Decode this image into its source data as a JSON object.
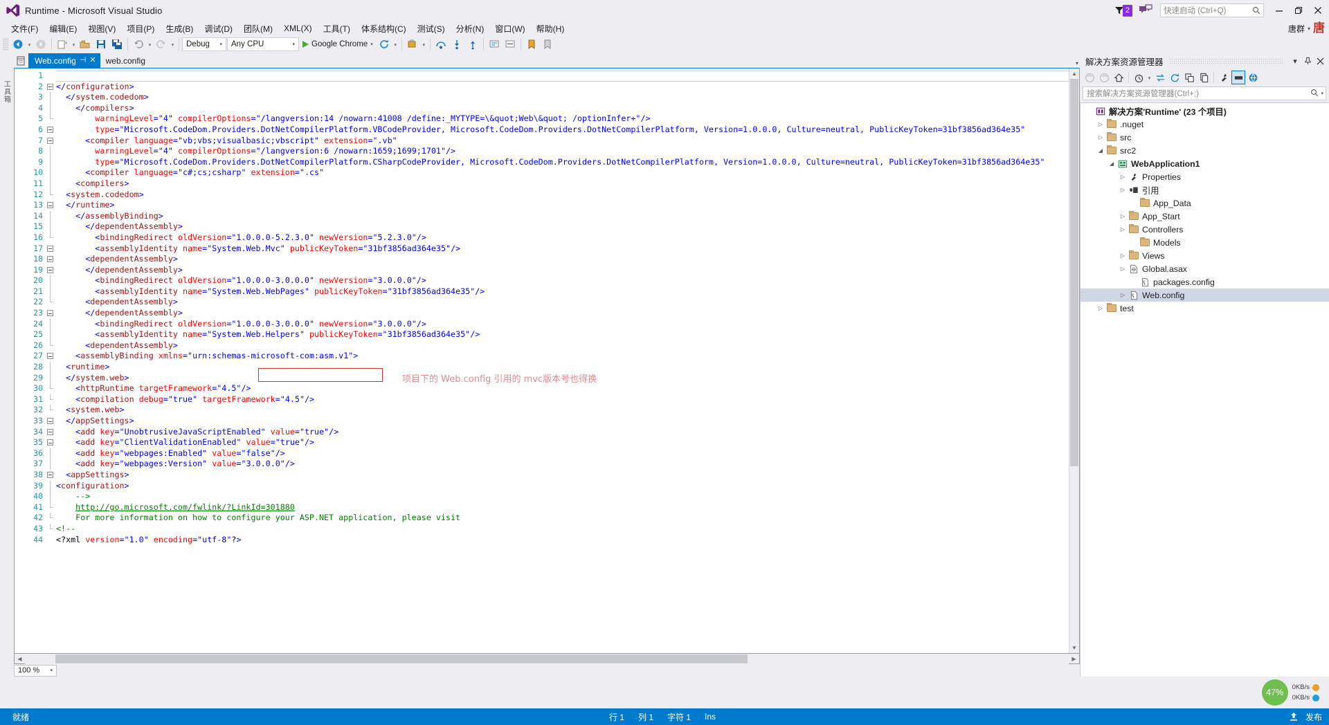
{
  "window": {
    "title": "Runtime - Microsoft Visual Studio",
    "logo_icon": "visual-studio-logo",
    "notification_count": "2",
    "notification_icon": "flag-icon",
    "feedback_icon": "feedback-icon",
    "quick_launch_placeholder": "快速启动 (Ctrl+Q)",
    "quick_launch_value": "",
    "search_icon": "search-icon",
    "minimize_label": "—",
    "restore_label": "❐",
    "close_label": "✕"
  },
  "account": {
    "name": "唐群",
    "avatar_text": "唐",
    "caret": "▾"
  },
  "menu": {
    "items": [
      {
        "label": "文件(F)"
      },
      {
        "label": "编辑(E)"
      },
      {
        "label": "视图(V)"
      },
      {
        "label": "项目(P)"
      },
      {
        "label": "生成(B)"
      },
      {
        "label": "调试(D)"
      },
      {
        "label": "团队(M)"
      },
      {
        "label": "XML(X)"
      },
      {
        "label": "工具(T)"
      },
      {
        "label": "体系结构(C)"
      },
      {
        "label": "测试(S)"
      },
      {
        "label": "分析(N)"
      },
      {
        "label": "窗口(W)"
      },
      {
        "label": "帮助(H)"
      }
    ]
  },
  "toolbar": {
    "navigate_back_icon": "navigate-back-icon",
    "navigate_forward_icon": "navigate-forward-icon",
    "new_project_icon": "new-project-icon",
    "open_file_icon": "open-file-icon",
    "save_icon": "save-icon",
    "save_all_icon": "save-all-icon",
    "undo_icon": "undo-icon",
    "redo_icon": "redo-icon",
    "config_value": "Debug",
    "platform_value": "Any CPU",
    "run_label": "Google Chrome",
    "run_icon": "play-icon",
    "refresh_icon": "refresh-icon",
    "dropdown_caret": "▾"
  },
  "left_rail": {
    "label": "工具箱"
  },
  "tabs": {
    "file_icon": "document-icon",
    "active": {
      "label": "Web.config",
      "pin": "⊣",
      "close": "✕"
    },
    "secondary": {
      "label": "web.config"
    },
    "overflow_caret": "▾"
  },
  "editor": {
    "zoom_level": "100 %",
    "zoom_caret": "▾",
    "annotation": "项目下的 Web.config 引用的 mvc版本号也得换",
    "lines": [
      {
        "n": 1,
        "indent": 0,
        "fold": "none",
        "text": "<?xml version=\"1.0\" encoding=\"utf-8\"?>"
      },
      {
        "n": 2,
        "indent": 0,
        "fold": "minus",
        "text": "<!--"
      },
      {
        "n": 3,
        "indent": 2,
        "fold": "bar",
        "text": "For more information on how to configure your ASP.NET application, please visit"
      },
      {
        "n": 4,
        "indent": 2,
        "fold": "bar",
        "text": "http://go.microsoft.com/fwlink/?LinkId=301880"
      },
      {
        "n": 5,
        "indent": 2,
        "fold": "end",
        "text": "-->"
      },
      {
        "n": 6,
        "indent": 0,
        "fold": "minus",
        "text": "<configuration>"
      },
      {
        "n": 7,
        "indent": 1,
        "fold": "minus",
        "text": "<appSettings>"
      },
      {
        "n": 8,
        "indent": 2,
        "fold": "bar",
        "text": "<add key=\"webpages:Version\" value=\"3.0.0.0\"/>"
      },
      {
        "n": 9,
        "indent": 2,
        "fold": "bar",
        "text": "<add key=\"webpages:Enabled\" value=\"false\"/>"
      },
      {
        "n": 10,
        "indent": 2,
        "fold": "bar",
        "text": "<add key=\"ClientValidationEnabled\" value=\"true\"/>"
      },
      {
        "n": 11,
        "indent": 2,
        "fold": "bar",
        "text": "<add key=\"UnobtrusiveJavaScriptEnabled\" value=\"true\"/>"
      },
      {
        "n": 12,
        "indent": 1,
        "fold": "end",
        "text": "</appSettings>"
      },
      {
        "n": 13,
        "indent": 1,
        "fold": "minus",
        "text": "<system.web>"
      },
      {
        "n": 14,
        "indent": 2,
        "fold": "bar",
        "text": "<compilation debug=\"true\" targetFramework=\"4.5\"/>"
      },
      {
        "n": 15,
        "indent": 2,
        "fold": "bar",
        "text": "<httpRuntime targetFramework=\"4.5\"/>"
      },
      {
        "n": 16,
        "indent": 1,
        "fold": "end",
        "text": "</system.web>"
      },
      {
        "n": 17,
        "indent": 1,
        "fold": "minus",
        "text": "<runtime>"
      },
      {
        "n": 18,
        "indent": 2,
        "fold": "minus",
        "text": "<assemblyBinding xmlns=\"urn:schemas-microsoft-com:asm.v1\">"
      },
      {
        "n": 19,
        "indent": 3,
        "fold": "minus",
        "text": "<dependentAssembly>"
      },
      {
        "n": 20,
        "indent": 4,
        "fold": "bar",
        "text": "<assemblyIdentity name=\"System.Web.Helpers\" publicKeyToken=\"31bf3856ad364e35\"/>"
      },
      {
        "n": 21,
        "indent": 4,
        "fold": "bar",
        "text": "<bindingRedirect oldVersion=\"1.0.0.0-3.0.0.0\" newVersion=\"3.0.0.0\"/>"
      },
      {
        "n": 22,
        "indent": 3,
        "fold": "end",
        "text": "</dependentAssembly>"
      },
      {
        "n": 23,
        "indent": 3,
        "fold": "minus",
        "text": "<dependentAssembly>"
      },
      {
        "n": 24,
        "indent": 4,
        "fold": "bar",
        "text": "<assemblyIdentity name=\"System.Web.WebPages\" publicKeyToken=\"31bf3856ad364e35\"/>"
      },
      {
        "n": 25,
        "indent": 4,
        "fold": "bar",
        "text": "<bindingRedirect oldVersion=\"1.0.0.0-3.0.0.0\" newVersion=\"3.0.0.0\"/>"
      },
      {
        "n": 26,
        "indent": 3,
        "fold": "end",
        "text": "</dependentAssembly>"
      },
      {
        "n": 27,
        "indent": 3,
        "fold": "minus",
        "text": "<dependentAssembly>"
      },
      {
        "n": 28,
        "indent": 4,
        "fold": "bar",
        "text": "<assemblyIdentity name=\"System.Web.Mvc\" publicKeyToken=\"31bf3856ad364e35\"/>"
      },
      {
        "n": 29,
        "indent": 4,
        "fold": "bar",
        "text": "<bindingRedirect oldVersion=\"1.0.0.0-5.2.3.0\" newVersion=\"5.2.3.0\"/>"
      },
      {
        "n": 30,
        "indent": 3,
        "fold": "end",
        "text": "</dependentAssembly>"
      },
      {
        "n": 31,
        "indent": 2,
        "fold": "end",
        "text": "</assemblyBinding>"
      },
      {
        "n": 32,
        "indent": 1,
        "fold": "end",
        "text": "</runtime>"
      },
      {
        "n": 33,
        "indent": 1,
        "fold": "minus",
        "text": "<system.codedom>"
      },
      {
        "n": 34,
        "indent": 2,
        "fold": "minus",
        "text": "<compilers>"
      },
      {
        "n": 35,
        "indent": 3,
        "fold": "minus",
        "text": "<compiler language=\"c#;cs;csharp\" extension=\".cs\""
      },
      {
        "n": 36,
        "indent": 4,
        "fold": "bar",
        "text": "type=\"Microsoft.CodeDom.Providers.DotNetCompilerPlatform.CSharpCodeProvider, Microsoft.CodeDom.Providers.DotNetCompilerPlatform, Version=1.0.0.0, Culture=neutral, PublicKeyToken=31bf3856ad364e35\""
      },
      {
        "n": 37,
        "indent": 4,
        "fold": "bar",
        "text": "warningLevel=\"4\" compilerOptions=\"/langversion:6 /nowarn:1659;1699;1701\"/>"
      },
      {
        "n": 38,
        "indent": 3,
        "fold": "minus",
        "text": "<compiler language=\"vb;vbs;visualbasic;vbscript\" extension=\".vb\""
      },
      {
        "n": 39,
        "indent": 4,
        "fold": "bar",
        "text": "type=\"Microsoft.CodeDom.Providers.DotNetCompilerPlatform.VBCodeProvider, Microsoft.CodeDom.Providers.DotNetCompilerPlatform, Version=1.0.0.0, Culture=neutral, PublicKeyToken=31bf3856ad364e35\""
      },
      {
        "n": 40,
        "indent": 4,
        "fold": "bar",
        "text": "warningLevel=\"4\" compilerOptions=\"/langversion:14 /nowarn:41008 /define:_MYTYPE=\\&quot;Web\\&quot; /optionInfer+\"/>"
      },
      {
        "n": 41,
        "indent": 2,
        "fold": "end",
        "text": "</compilers>"
      },
      {
        "n": 42,
        "indent": 1,
        "fold": "end",
        "text": "</system.codedom>"
      },
      {
        "n": 43,
        "indent": 0,
        "fold": "end",
        "text": "</configuration>"
      },
      {
        "n": 44,
        "indent": 0,
        "fold": "none",
        "text": ""
      }
    ]
  },
  "solution_explorer": {
    "title": "解决方案资源管理器",
    "dropdown_icon": "chevron-down-icon",
    "pin_icon": "pin-icon",
    "close_icon": "close-icon",
    "toolbar_icons": [
      "back-icon",
      "forward-icon",
      "home-icon",
      "pending-changes-icon",
      "sync-icon",
      "refresh-icon",
      "collapse-all-icon",
      "show-all-files-icon",
      "properties-icon",
      "preview-selected-items-icon",
      "view-code-icon"
    ],
    "search_placeholder": "搜索解决方案资源管理器(Ctrl+;)",
    "search_icon": "search-icon",
    "search_caret": "▾",
    "tree": [
      {
        "depth": 0,
        "expander": "",
        "icon": "solution-icon",
        "label": "解决方案'Runtime' (23 个项目)",
        "bold": true,
        "selected": false
      },
      {
        "depth": 1,
        "expander": "▷",
        "icon": "folder-icon",
        "label": ".nuget",
        "bold": false,
        "selected": false
      },
      {
        "depth": 1,
        "expander": "▷",
        "icon": "folder-icon",
        "label": "src",
        "bold": false,
        "selected": false
      },
      {
        "depth": 1,
        "expander": "◢",
        "icon": "folder-icon",
        "label": "src2",
        "bold": false,
        "selected": false
      },
      {
        "depth": 2,
        "expander": "◢",
        "icon": "project-icon",
        "label": "WebApplication1",
        "bold": true,
        "selected": false
      },
      {
        "depth": 3,
        "expander": "▷",
        "icon": "wrench-icon",
        "label": "Properties",
        "bold": false,
        "selected": false
      },
      {
        "depth": 3,
        "expander": "▷",
        "icon": "references-icon",
        "label": "引用",
        "bold": false,
        "selected": false
      },
      {
        "depth": 4,
        "expander": "",
        "icon": "folder-icon",
        "label": "App_Data",
        "bold": false,
        "selected": false
      },
      {
        "depth": 3,
        "expander": "▷",
        "icon": "folder-icon",
        "label": "App_Start",
        "bold": false,
        "selected": false
      },
      {
        "depth": 3,
        "expander": "▷",
        "icon": "folder-icon",
        "label": "Controllers",
        "bold": false,
        "selected": false
      },
      {
        "depth": 4,
        "expander": "",
        "icon": "folder-icon",
        "label": "Models",
        "bold": false,
        "selected": false
      },
      {
        "depth": 3,
        "expander": "▷",
        "icon": "folder-icon",
        "label": "Views",
        "bold": false,
        "selected": false
      },
      {
        "depth": 3,
        "expander": "▷",
        "icon": "asax-icon",
        "label": "Global.asax",
        "bold": false,
        "selected": false
      },
      {
        "depth": 4,
        "expander": "",
        "icon": "config-icon",
        "label": "packages.config",
        "bold": false,
        "selected": false
      },
      {
        "depth": 3,
        "expander": "▷",
        "icon": "config-icon",
        "label": "Web.config",
        "bold": false,
        "selected": true
      },
      {
        "depth": 1,
        "expander": "▷",
        "icon": "folder-icon",
        "label": "test",
        "bold": false,
        "selected": false
      }
    ]
  },
  "performance": {
    "value": "47%",
    "caret": "▾",
    "rows": [
      {
        "label": "0KB/s",
        "color": "#f09a28"
      },
      {
        "label": "0KB/s",
        "color": "#1f9bde"
      }
    ]
  },
  "statusbar": {
    "state": "就绪",
    "line_label": "行 1",
    "col_label": "列 1",
    "char_label": "字符 1",
    "insert_mode": "Ins",
    "publish_label": "发布",
    "publish_icon": "publish-icon",
    "bg_color": "#007acc"
  }
}
